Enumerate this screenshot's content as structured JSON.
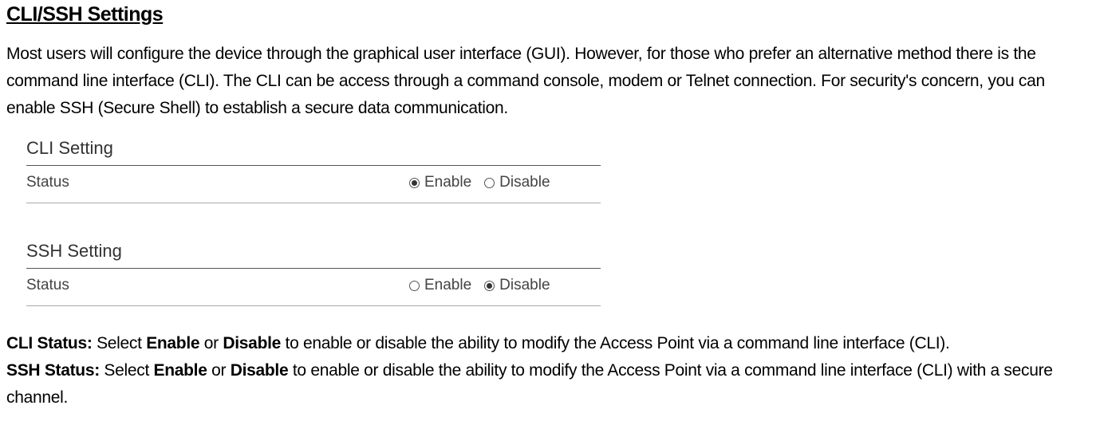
{
  "title": "CLI/SSH Settings",
  "intro": "Most users will configure the device through the graphical user interface (GUI). However, for those who prefer an alternative method there is the command line interface (CLI). The CLI can be access through a command console, modem or Telnet connection. For security's concern, you can enable SSH (Secure Shell) to establish a secure data communication.",
  "panel": {
    "cli": {
      "heading": "CLI Setting",
      "rowLabel": "Status",
      "enableLabel": "Enable",
      "disableLabel": "Disable",
      "selected": "enable"
    },
    "ssh": {
      "heading": "SSH Setting",
      "rowLabel": "Status",
      "enableLabel": "Enable",
      "disableLabel": "Disable",
      "selected": "disable"
    }
  },
  "desc": {
    "cli": {
      "label": "CLI Status:",
      "pre": " Select ",
      "opt1": "Enable",
      "mid": " or ",
      "opt2": "Disable",
      "post": " to enable or disable the ability to modify the Access Point via a command line interface (CLI)."
    },
    "ssh": {
      "label": "SSH Status:",
      "pre": " Select ",
      "opt1": "Enable",
      "mid": " or ",
      "opt2": "Disable",
      "post": " to enable or disable the ability to modify the Access Point via a command line interface (CLI) with a secure channel."
    }
  }
}
